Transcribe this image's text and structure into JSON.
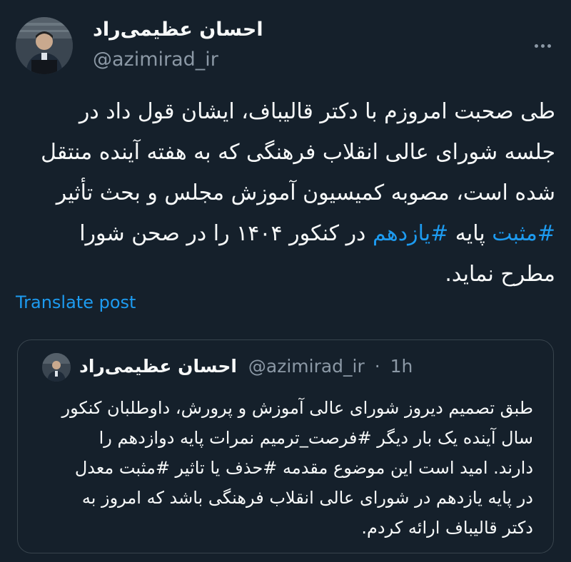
{
  "author": {
    "name": "احسان عظیمی‌راد",
    "handle": "@azimirad_ir"
  },
  "tweet": {
    "lines": [
      {
        "text": "طی صحبت امروزم با دکتر قالیباف، ایشان قول داد در"
      },
      {
        "text": "جلسه شورای عالی انقلاب فرهنگی که به هفته آینده منتقل"
      },
      {
        "text": "شده است، مصوبه کمیسیون آموزش مجلس و بحث تأثیر"
      },
      {
        "tag1": "#مثبت",
        "mid": " پایه ",
        "tag2": "#یازدهم",
        "rest": " در کنکور ۱۴۰۴ را در صحن شورا"
      },
      {
        "text": "مطرح نماید."
      }
    ],
    "translate_label": "Translate post"
  },
  "quoted": {
    "name": "احسان عظیمی‌راد",
    "handle": "@azimirad_ir",
    "separator": "·",
    "time": "1h",
    "lines": [
      "طبق تصمیم دیروز شورای عالی آموزش و پرورش، داوطلبان کنکور",
      "سال آینده یک بار دیگر #فرصت_ترمیم نمرات پایه دوازدهم را",
      "دارند. امید است این موضوع مقدمه #حذف یا تاثیر #مثبت معدل",
      "در پایه یازدهم در شورای عالی انقلاب فرهنگی باشد که امروز به",
      "دکتر قالیباف ارائه کردم."
    ]
  },
  "icons": {
    "more": "more-dots-icon"
  },
  "colors": {
    "background": "#15202b",
    "text": "#f7f9f9",
    "secondary": "#8b98a5",
    "link": "#1d9bf0",
    "border": "#38444d"
  }
}
